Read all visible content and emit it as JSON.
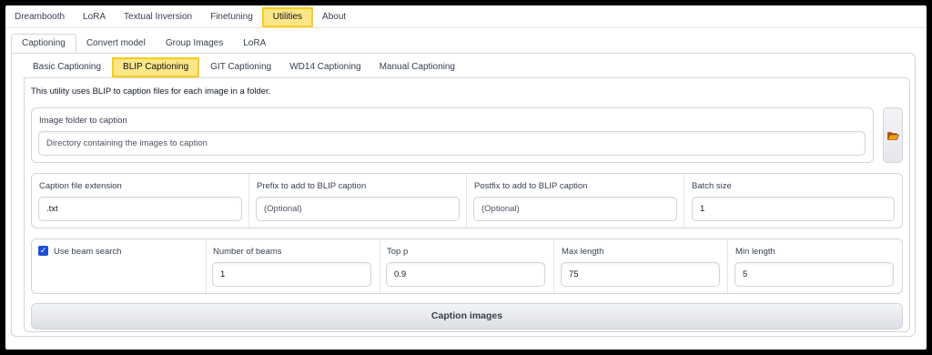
{
  "tabs_top": [
    "Dreambooth",
    "LoRA",
    "Textual Inversion",
    "Finetuning",
    "Utilities",
    "About"
  ],
  "tabs_utilities": [
    "Captioning",
    "Convert model",
    "Group Images",
    "LoRA"
  ],
  "tabs_captioning": [
    "Basic Captioning",
    "BLIP Captioning",
    "GIT Captioning",
    "WD14 Captioning",
    "Manual Captioning"
  ],
  "description": "This utility uses BLIP to caption files for each image in a folder.",
  "image_folder": {
    "label": "Image folder to caption",
    "placeholder": "Directory containing the images to caption"
  },
  "fields_row1": {
    "caption_ext": {
      "label": "Caption file extension",
      "value": ".txt"
    },
    "prefix": {
      "label": "Prefix to add to BLIP caption",
      "placeholder": "(Optional)"
    },
    "postfix": {
      "label": "Postfix to add to BLIP caption",
      "placeholder": "(Optional)"
    },
    "batch_size": {
      "label": "Batch size",
      "value": "1"
    }
  },
  "fields_row2": {
    "beam_search": {
      "label": "Use beam search",
      "checked": true
    },
    "num_beams": {
      "label": "Number of beams",
      "value": "1"
    },
    "top_p": {
      "label": "Top p",
      "value": "0.9"
    },
    "max_length": {
      "label": "Max length",
      "value": "75"
    },
    "min_length": {
      "label": "Min length",
      "value": "5"
    }
  },
  "caption_button": "Caption images",
  "colors": {
    "highlight": "#fde68a",
    "highlight_border": "#facc15",
    "checkbox": "#1d4ed8"
  },
  "icons": {
    "folder": "folder-open-icon",
    "checkbox": "checkmark-icon"
  }
}
